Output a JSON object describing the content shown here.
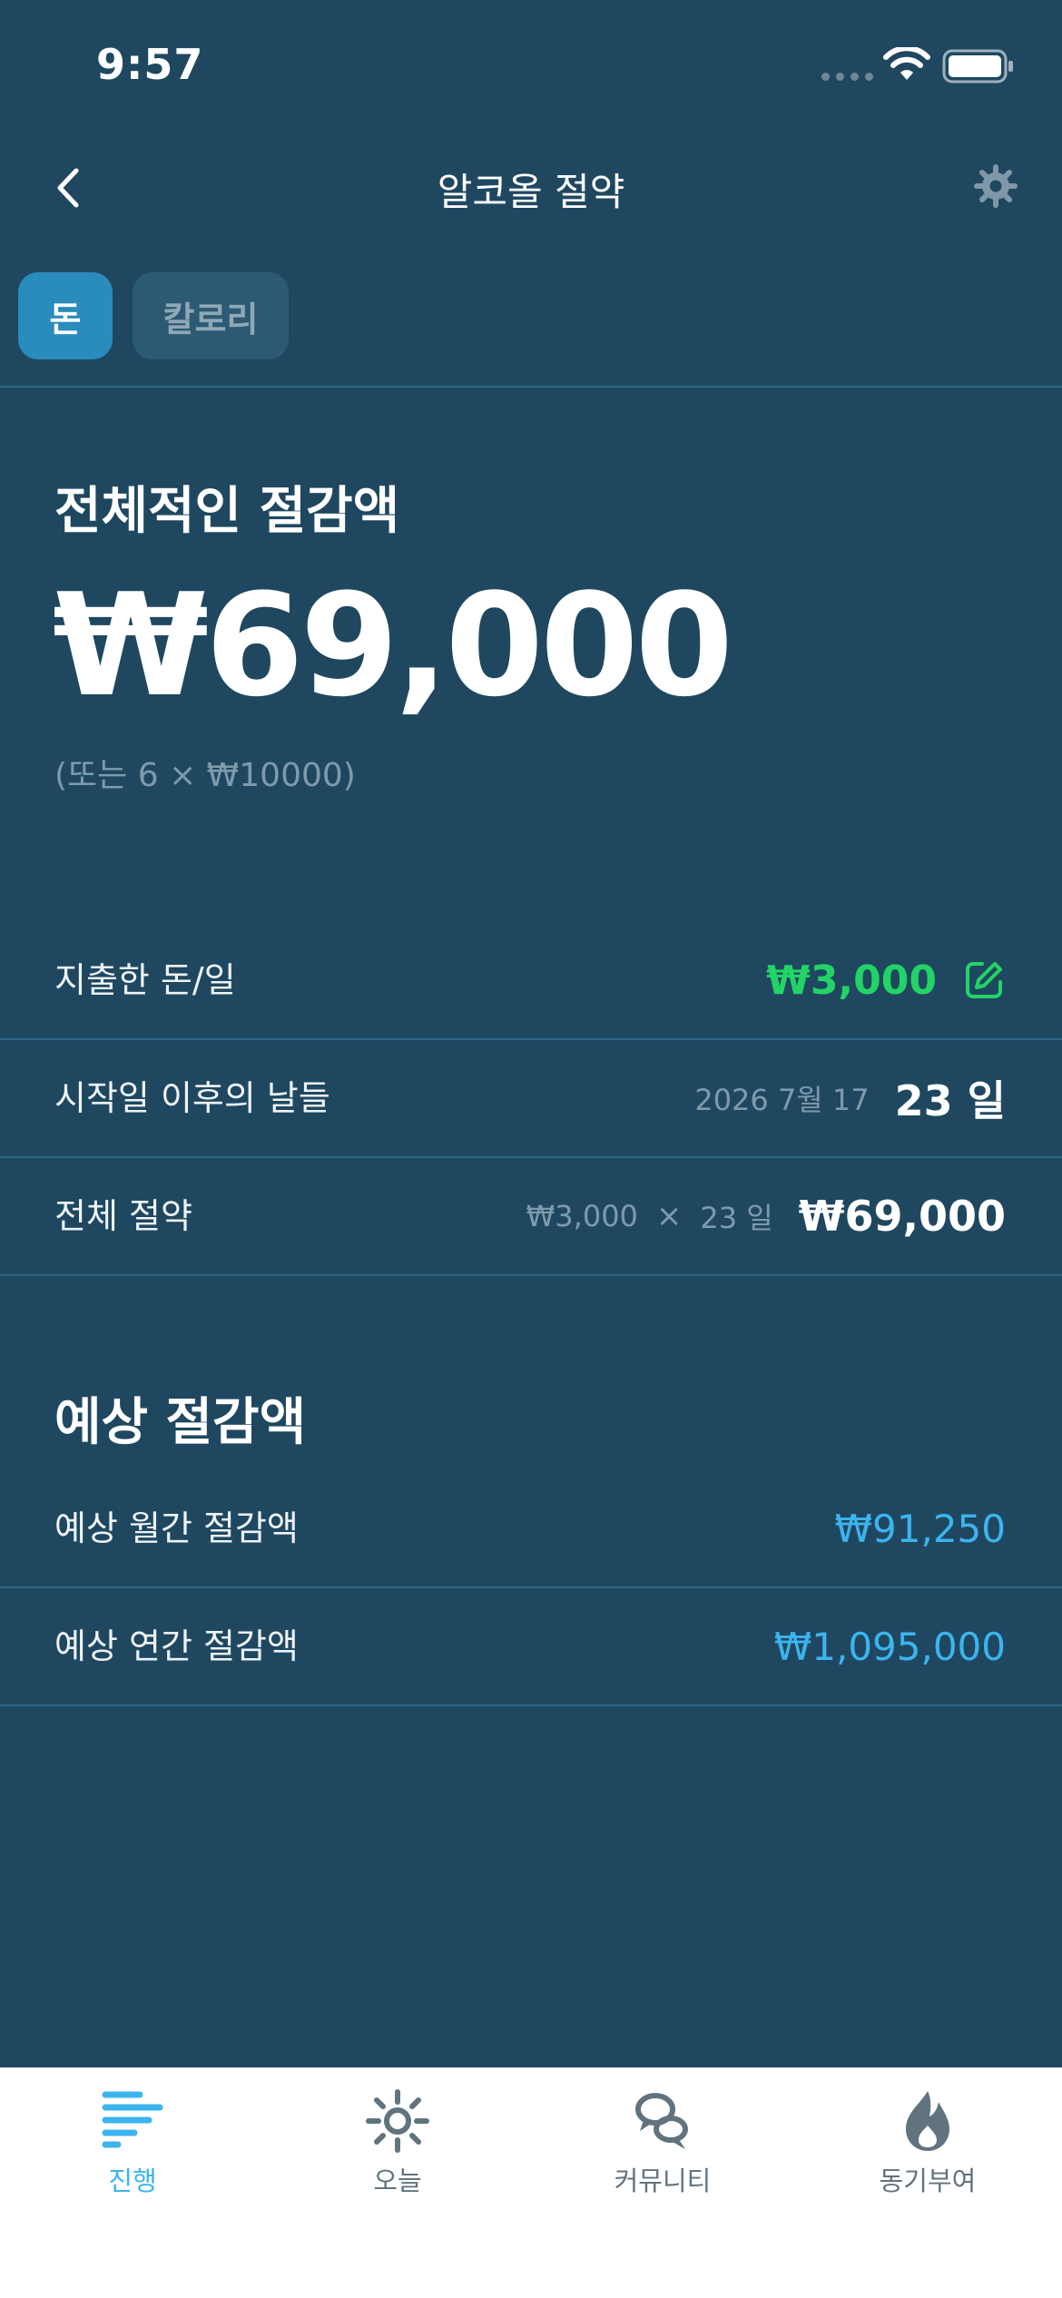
{
  "status_bar": {
    "time": "9:57"
  },
  "nav": {
    "title": "알코올 절약"
  },
  "tabs": [
    {
      "label": "돈",
      "active": true
    },
    {
      "label": "칼로리",
      "active": false
    }
  ],
  "overall": {
    "title": "전체적인 절감액",
    "value": "₩69,000",
    "subtitle": "(또는 6 × ₩10000)"
  },
  "details": {
    "spent": {
      "label": "지출한 돈/일",
      "value": "₩3,000"
    },
    "days": {
      "label": "시작일 이후의 날들",
      "start_date": "2026 7월 17",
      "value": "23 일"
    },
    "total": {
      "label": "전체 절약",
      "calc_left": "₩3,000",
      "calc_sign": "×",
      "calc_right": "23 일",
      "value": "₩69,000"
    }
  },
  "projected": {
    "title": "예상 절감액",
    "monthly": {
      "label": "예상 월간 절감액",
      "value": "₩91,250"
    },
    "yearly": {
      "label": "예상 연간 절감액",
      "value": "₩1,095,000"
    }
  },
  "tabbar": [
    {
      "label": "진행",
      "icon": "progress-bars-icon",
      "active": true
    },
    {
      "label": "오늘",
      "icon": "sun-icon",
      "active": false
    },
    {
      "label": "커뮤니티",
      "icon": "chat-bubbles-icon",
      "active": false
    },
    {
      "label": "동기부여",
      "icon": "flame-icon",
      "active": false
    }
  ],
  "colors": {
    "background": "#1f4860",
    "accent_blue": "#3cb4ee",
    "accent_green": "#22d466",
    "tab_active": "#2a8bbd",
    "divider": "#2d6685"
  }
}
